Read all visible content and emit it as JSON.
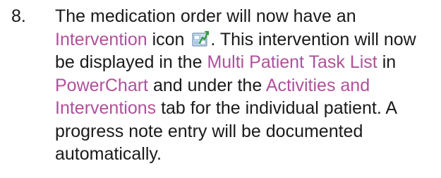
{
  "step": {
    "number": "8.",
    "segments": [
      {
        "text": "The medication order will now have an ",
        "style": "plain"
      },
      {
        "text": "Intervention",
        "style": "keyword"
      },
      {
        "text": " icon ",
        "style": "plain"
      },
      {
        "icon": "intervention-icon"
      },
      {
        "text": ". This intervention will now be displayed in the ",
        "style": "plain"
      },
      {
        "text": "Multi Patient Task List",
        "style": "keyword"
      },
      {
        "text": " in ",
        "style": "plain"
      },
      {
        "text": "PowerChart",
        "style": "keyword"
      },
      {
        "text": " and under the ",
        "style": "plain"
      },
      {
        "text": "Activities and Interventions",
        "style": "keyword"
      },
      {
        "text": " tab for the individual patient. A progress note entry will be documented automatically.",
        "style": "plain"
      }
    ]
  },
  "colors": {
    "text": "#1a1a1a",
    "keyword": "#b0519a"
  }
}
